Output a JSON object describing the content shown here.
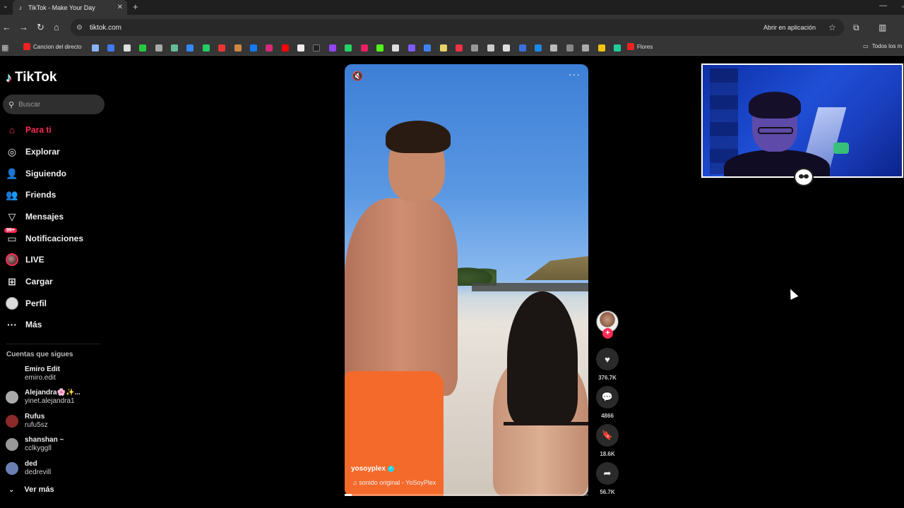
{
  "browser": {
    "tab_title": "TikTok - Make Your Day",
    "tab_close": "✕",
    "new_tab": "+",
    "url": "tiktok.com",
    "open_in_app": "Abrir en aplicación",
    "bookmarks": {
      "first": "Cancion del directo",
      "last": "Flores",
      "all": "Todos los m"
    }
  },
  "tiktok": {
    "brand": "TikTok",
    "search": {
      "placeholder": "Buscar"
    },
    "nav": [
      {
        "label": "Para ti",
        "icon": "home-icon",
        "active": true
      },
      {
        "label": "Explorar",
        "icon": "compass-icon"
      },
      {
        "label": "Siguiendo",
        "icon": "following-icon"
      },
      {
        "label": "Friends",
        "icon": "friends-icon"
      },
      {
        "label": "Mensajes",
        "icon": "inbox-icon"
      },
      {
        "label": "Notificaciones",
        "icon": "notifications-icon",
        "badge": "99+"
      },
      {
        "label": "LIVE",
        "icon": "live-avatar"
      },
      {
        "label": "Cargar",
        "icon": "upload-icon"
      },
      {
        "label": "Perfil",
        "icon": "profile-avatar"
      },
      {
        "label": "Más",
        "icon": "more-icon"
      }
    ],
    "following_title": "Cuentas que sigues",
    "following": [
      {
        "name": "Emiro Edit",
        "handle": "emiro.edit"
      },
      {
        "name": "Alejandra🌸✨...",
        "handle": "yinet.alejandra1"
      },
      {
        "name": "Rufus",
        "handle": "rufu5sz"
      },
      {
        "name": "shanshan ~",
        "handle": "cclkyggll"
      },
      {
        "name": "ded",
        "handle": "dedrevill"
      }
    ],
    "see_more": "Ver más"
  },
  "video": {
    "author": "yosoyplex",
    "sound": "sonido original - YoSoyPlex",
    "likes": "376.7K",
    "comments": "4866",
    "saves": "18.6K",
    "shares": "56.7K",
    "progress": 0.03
  },
  "colors": {
    "accent": "#fe2c55",
    "verified": "#20d5ec"
  }
}
